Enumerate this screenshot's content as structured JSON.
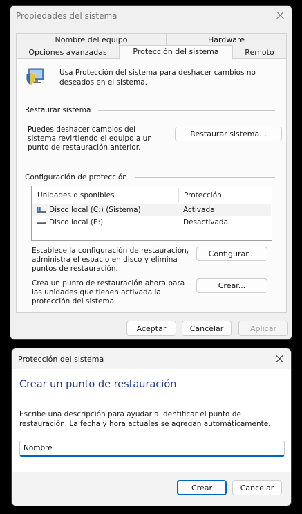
{
  "props_window": {
    "title": "Propiedades del sistema",
    "tabs_top": [
      "Nombre del equipo",
      "Hardware"
    ],
    "tabs_bottom": [
      "Opciones avanzadas",
      "Protección del sistema",
      "Remoto"
    ],
    "active_tab": "Protección del sistema",
    "intro": "Usa Protección del sistema para deshacer cambios no deseados en el sistema.",
    "restore": {
      "section_label": "Restaurar sistema",
      "description": "Puedes deshacer cambios del sistema revirtiendo el equipo a un punto de restauración anterior.",
      "button": "Restaurar sistema..."
    },
    "protection": {
      "section_label": "Configuración de protección",
      "columns": [
        "Unidades disponibles",
        "Protección"
      ],
      "rows": [
        {
          "drive": "Disco local (C:) (Sistema)",
          "protection": "Activada",
          "icon": "system-drive-icon"
        },
        {
          "drive": "Disco local (E:)",
          "protection": "Desactivada",
          "icon": "drive-icon"
        }
      ],
      "configure_text": "Establece la configuración de restauración, administra el espacio en disco y elimina puntos de restauración.",
      "configure_button": "Configurar...",
      "create_text": "Crea un punto de restauración ahora para las unidades que tienen activada la protección del sistema.",
      "create_button": "Crear..."
    },
    "footer": {
      "ok": "Aceptar",
      "cancel": "Cancelar",
      "apply": "Aplicar"
    }
  },
  "create_dialog": {
    "title": "Protección del sistema",
    "heading": "Crear un punto de restauración",
    "description": "Escribe una descripción para ayudar a identificar el punto de restauración. La fecha y hora actuales se agregan automáticamente.",
    "input_value": "Nombre",
    "create_button": "Crear",
    "cancel_button": "Cancelar"
  },
  "colors": {
    "accent": "#0067c0",
    "heading": "#1c3f94"
  }
}
